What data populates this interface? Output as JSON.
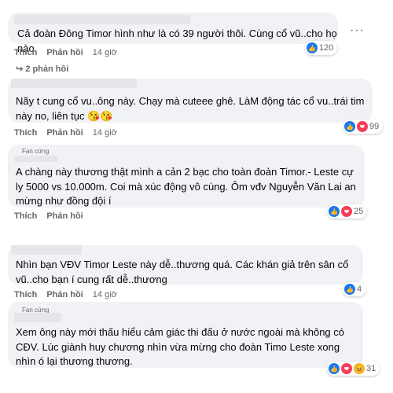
{
  "actions": {
    "like_label": "Thích",
    "reply_label": "Phản hồi"
  },
  "more_icon": "···",
  "comments": [
    {
      "text": "Cả đoàn Đông Timor hình như là có 39 người thôi. Cùng cổ vũ..cho họ nào.",
      "time": "14 giờ",
      "reactions": [
        "like"
      ],
      "count": "120"
    },
    {
      "text": "Nãy t cung cổ vu..ông này. Chạy mà cuteee ghê. LàM động tác cổ vu..trái tim này no, liên tục 😘😘",
      "time": "14 giờ",
      "reactions": [
        "like",
        "love"
      ],
      "count": "99"
    },
    {
      "label": "Fan cứng",
      "text": "A chàng này thương thật mình a cản 2 bạc cho toàn đoàn Timor.- Leste cự ly 5000 vs 10.000m. Coi mà xúc động vô cùng. Ôm vđv Nguyễn Văn Lai an mừng như đồng đội í",
      "time": "",
      "reactions": [
        "like",
        "love"
      ],
      "count": "25"
    },
    {
      "text": "Nhìn bạn VĐV Timor Leste này dễ..thương quá. Các khán giả trên sân cổ vũ..cho bạn í cung rất dễ..thương",
      "time": "14 giờ",
      "reactions": [
        "like"
      ],
      "count": "4"
    },
    {
      "label": "Fan cứng",
      "text": "Xem ông này mới thấu hiểu cảm giác thi đấu ở nước ngoài mà không có CĐV. Lúc giành huy chương nhìn vừa mừng cho đoàn Timo Leste xong nhìn ó lại thương thương.",
      "time": "",
      "reactions": [
        "like",
        "love",
        "haha"
      ],
      "count": "31"
    }
  ],
  "replies_link": "2 phản hồi"
}
